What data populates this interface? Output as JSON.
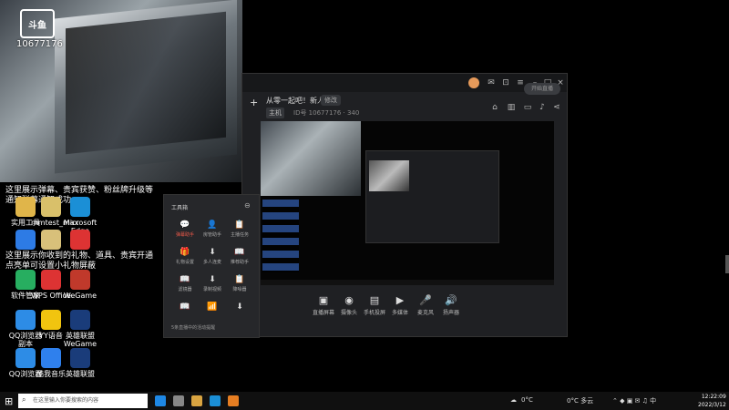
{
  "overlay": {
    "logo_text": "斗鱼",
    "room_id": "10677176"
  },
  "desktop": {
    "notice_1": [
      "这里展示弹幕、贵宾获赞、粉丝牌升级等",
      "通知弹幕通知成功"
    ],
    "notice_2": [
      "这里展示你收到的礼物、道具、贵宾开通",
      "点亮单可设置小礼物屏蔽"
    ],
    "icons": [
      {
        "label": "实用工具",
        "color": "#e0b54a"
      },
      {
        "label": "mmtest_max",
        "color": "#d9c06a"
      },
      {
        "label": "Microsoft Edge",
        "color": "#1b8fd6"
      },
      {
        "label": "",
        "color": "#2d7be5"
      },
      {
        "label": "",
        "color": "#d8c07a"
      },
      {
        "label": "",
        "color": "#d33"
      },
      {
        "label": "软件管家",
        "color": "#27ae60"
      },
      {
        "label": "WPS Office",
        "color": "#d33"
      },
      {
        "label": "WeGame",
        "color": "#c0392b"
      },
      {
        "label": "QQ浏览器 副本",
        "color": "#2d8ce6"
      },
      {
        "label": "YY语音",
        "color": "#f1c40f"
      },
      {
        "label": "英雄联盟 WeGame版",
        "color": "#1a3c7a"
      },
      {
        "label": "QQ浏览器",
        "color": "#2d8ce6"
      },
      {
        "label": "酷我音乐",
        "color": "#2f80ed"
      },
      {
        "label": "英雄联盟",
        "color": "#1a3c7a"
      }
    ]
  },
  "app": {
    "room_title": "从零一起吧！新人报道",
    "room_tag": "修改",
    "room_category": "主机",
    "room_meta": "ID号  10677176  · 340"
  },
  "toolbox": {
    "title": "工具箱",
    "items": [
      {
        "label": "弹幕助手",
        "icon": "💬",
        "active": true
      },
      {
        "label": "房管助手",
        "icon": "👤",
        "active": false
      },
      {
        "label": "主播任务",
        "icon": "📋",
        "active": false
      },
      {
        "label": "礼物设置",
        "icon": "🎁",
        "active": false
      },
      {
        "label": "多人连麦",
        "icon": "⬇",
        "active": false
      },
      {
        "label": "推荐助手",
        "icon": "📖",
        "active": false
      },
      {
        "label": "滤镜器",
        "icon": "📖",
        "active": false
      },
      {
        "label": "录制视频",
        "icon": "⬇",
        "active": false
      },
      {
        "label": "降噪器",
        "icon": "📋",
        "active": false
      },
      {
        "label": "",
        "icon": "📖",
        "active": false
      },
      {
        "label": "",
        "icon": "📶",
        "active": false
      },
      {
        "label": "",
        "icon": "⬇",
        "active": false
      }
    ],
    "footer": "5条直播中的活动提醒"
  },
  "controls": [
    {
      "label": "直播屏幕",
      "icon": "▣"
    },
    {
      "label": "摄像头",
      "icon": "◉"
    },
    {
      "label": "手机投屏",
      "icon": "▤"
    },
    {
      "label": "多媒体",
      "icon": "▶"
    },
    {
      "label": "麦克风",
      "icon": "🎤"
    },
    {
      "label": "扬声器",
      "icon": "🔊"
    }
  ],
  "go_live": "开始直播",
  "taskbar": {
    "search_placeholder": "在这里输入你要搜索的内容",
    "weather_1": "0°C",
    "weather_2": "0°C 多云",
    "time": "12:22:09",
    "date": "2022/3/12"
  }
}
